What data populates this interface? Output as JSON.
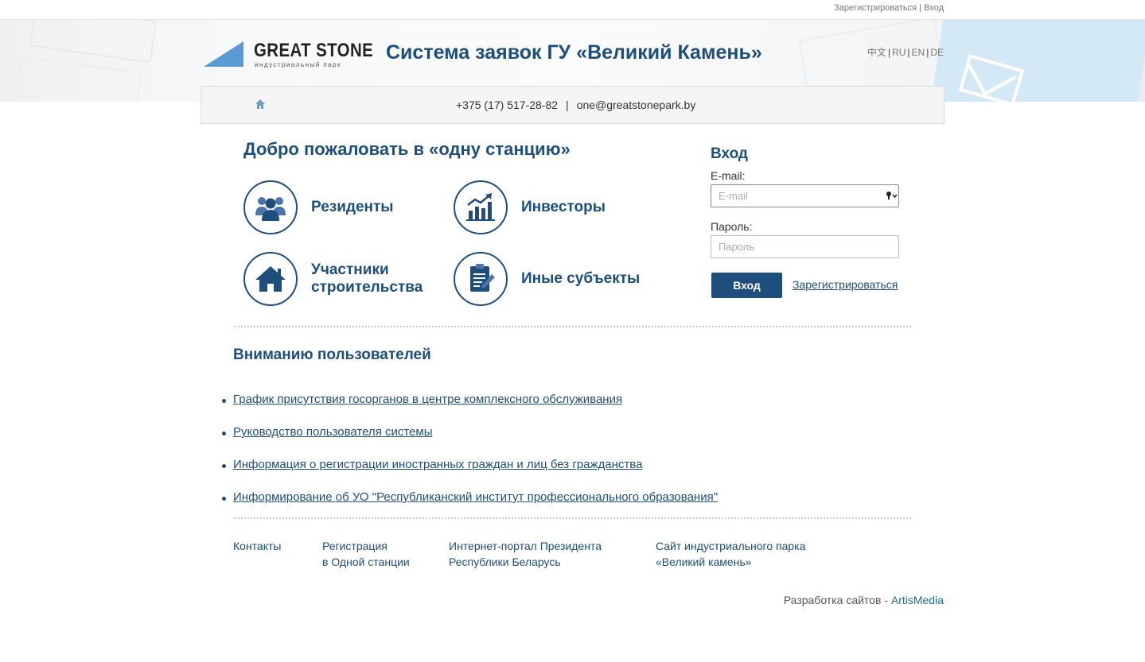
{
  "topbar": {
    "register": "Зарегистрироваться",
    "sep": " | ",
    "login": "Вход"
  },
  "logo": {
    "name": "GREAT STONE",
    "subtitle": "индустриальный парк"
  },
  "header": {
    "title": "Система заявок ГУ «Великий Камень»"
  },
  "languages": [
    "中文",
    "RU",
    "EN",
    "DE"
  ],
  "contact": {
    "phone": "+375 (17) 517-28-82",
    "separator": "|",
    "email": "one@greatstonepark.by"
  },
  "welcome": "Добро пожаловать в «одну станцию»",
  "categories": [
    {
      "label": "Резиденты",
      "icon": "people-icon"
    },
    {
      "label": "Инвесторы",
      "icon": "growth-chart-icon"
    },
    {
      "label": "Участники строительства",
      "icon": "house-icon"
    },
    {
      "label": "Иные субъекты",
      "icon": "document-pen-icon"
    }
  ],
  "login": {
    "title": "Вход",
    "email_label": "E-mail:",
    "email_placeholder": "E-mail",
    "password_label": "Пароль:",
    "password_placeholder": "Пароль",
    "submit": "Вход",
    "register": "Зарегистрироваться"
  },
  "notices": {
    "title": "Вниманию пользователей",
    "items": [
      "График присутствия госорганов в центре комплексного обслуживания",
      "Руководство пользователя системы",
      "Информация о регистрации иностранных граждан и лиц без гражданства",
      "Информирование об УО \"Республиканский институт профессионального образования\""
    ]
  },
  "footer": {
    "links": [
      {
        "line1": "Контакты",
        "line2": ""
      },
      {
        "line1": "Регистрация",
        "line2": "в Одной станции"
      },
      {
        "line1": "Интернет-портал Президента",
        "line2": "Республики Беларусь"
      },
      {
        "line1": "Сайт индустриального парка",
        "line2": "«Великий камень»"
      }
    ],
    "dev_prefix": "Разработка сайтов - ",
    "dev_name": "ArtisMedia"
  },
  "colors": {
    "brand": "#1d4e7c",
    "link": "#1d6aa5"
  }
}
